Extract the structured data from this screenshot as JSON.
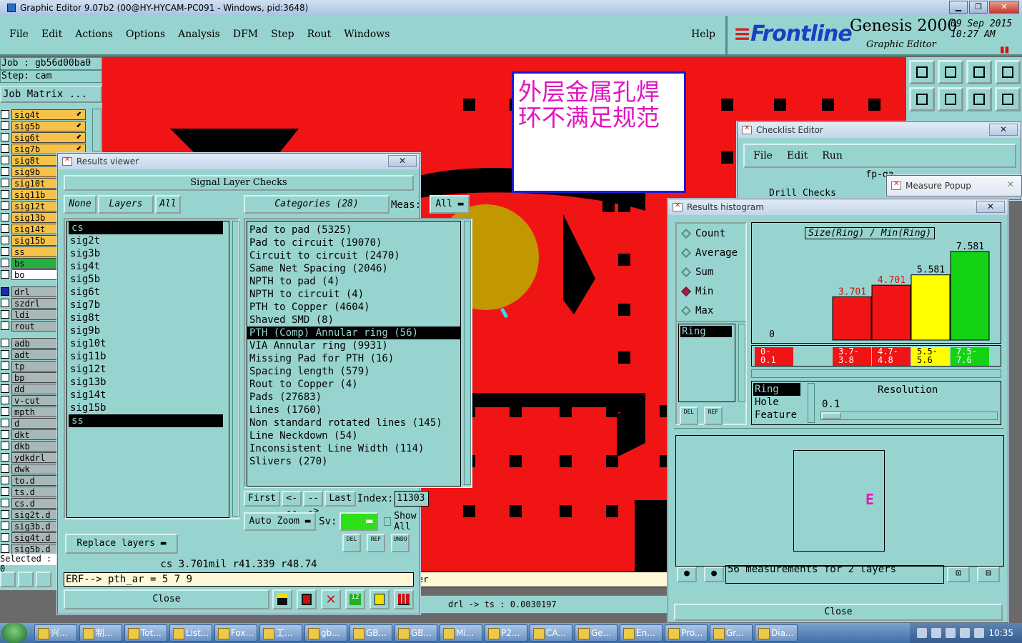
{
  "window": {
    "title": "Graphic Editor 9.07b2 (00@HY-HYCAM-PC091 - Windows, pid:3648)"
  },
  "menu": {
    "items": [
      "File",
      "Edit",
      "Actions",
      "Options",
      "Analysis",
      "DFM",
      "Step",
      "Rout",
      "Windows"
    ],
    "help": "Help"
  },
  "brand": {
    "logo": "Frontline",
    "product": "Genesis 2000",
    "subtitle": "Graphic Editor",
    "date": "09 Sep 2015",
    "time": "10:27 AM"
  },
  "left": {
    "job": "Job : gb56d00ba0",
    "step": "Step: cam",
    "job_matrix": "Job Matrix ...",
    "layers": [
      {
        "name": "sig4t",
        "color": "#f6c24a",
        "checked": false,
        "arrow": true
      },
      {
        "name": "sig5b",
        "color": "#f6c24a",
        "checked": false,
        "arrow": true
      },
      {
        "name": "sig6t",
        "color": "#f6c24a",
        "checked": false,
        "arrow": true
      },
      {
        "name": "sig7b",
        "color": "#f6c24a",
        "checked": false,
        "arrow": true
      },
      {
        "name": "sig8t",
        "color": "#f6c24a",
        "checked": false,
        "arrow": true
      },
      {
        "name": "sig9b",
        "color": "#f6c24a",
        "checked": false,
        "arrow": true
      },
      {
        "name": "sig10t",
        "color": "#f6c24a",
        "checked": false,
        "arrow": false
      },
      {
        "name": "sig11b",
        "color": "#f6c24a",
        "checked": false,
        "arrow": false
      },
      {
        "name": "sig12t",
        "color": "#f6c24a",
        "checked": false,
        "arrow": false
      },
      {
        "name": "sig13b",
        "color": "#f6c24a",
        "checked": false,
        "arrow": false
      },
      {
        "name": "sig14t",
        "color": "#f6c24a",
        "checked": false,
        "arrow": false
      },
      {
        "name": "sig15b",
        "color": "#f6c24a",
        "checked": false,
        "arrow": false
      },
      {
        "name": "ss",
        "color": "#f6c24a",
        "checked": false,
        "arrow": false
      },
      {
        "name": "bs",
        "color": "#25b040",
        "checked": false,
        "arrow": false
      },
      {
        "name": "bo",
        "color": "#ffffff",
        "checked": false,
        "arrow": false
      },
      {
        "name": "",
        "color": "#98d4cf",
        "checked": false,
        "arrow": false
      },
      {
        "name": "drl",
        "color": "#a8b8b8",
        "checked": true,
        "arrow": false
      },
      {
        "name": "szdrl",
        "color": "#a8b8b8",
        "checked": false,
        "arrow": false
      },
      {
        "name": "ldi",
        "color": "#a8b8b8",
        "checked": false,
        "arrow": false
      },
      {
        "name": "rout",
        "color": "#a8b8b8",
        "checked": false,
        "arrow": false
      },
      {
        "name": "",
        "color": "#98d4cf",
        "checked": false,
        "arrow": false
      },
      {
        "name": "adb",
        "color": "#a8b8b8",
        "checked": false,
        "arrow": false
      },
      {
        "name": "adt",
        "color": "#a8b8b8",
        "checked": false,
        "arrow": false
      },
      {
        "name": "tp",
        "color": "#a8b8b8",
        "checked": false,
        "arrow": false
      },
      {
        "name": "bp",
        "color": "#a8b8b8",
        "checked": false,
        "arrow": false
      },
      {
        "name": "dd",
        "color": "#a8b8b8",
        "checked": false,
        "arrow": false
      },
      {
        "name": "v-cut",
        "color": "#a8b8b8",
        "checked": false,
        "arrow": false
      },
      {
        "name": "mpth",
        "color": "#a8b8b8",
        "checked": false,
        "arrow": false
      },
      {
        "name": "d",
        "color": "#a8b8b8",
        "checked": false,
        "arrow": false
      },
      {
        "name": "dkt",
        "color": "#a8b8b8",
        "checked": false,
        "arrow": false
      },
      {
        "name": "dkb",
        "color": "#a8b8b8",
        "checked": false,
        "arrow": false
      },
      {
        "name": "ydkdrl",
        "color": "#a8b8b8",
        "checked": false,
        "arrow": false
      },
      {
        "name": "dwk",
        "color": "#a8b8b8",
        "checked": false,
        "arrow": false
      },
      {
        "name": "to.d",
        "color": "#a8b8b8",
        "checked": false,
        "arrow": false
      },
      {
        "name": "ts.d",
        "color": "#a8b8b8",
        "checked": false,
        "arrow": false
      },
      {
        "name": "cs.d",
        "color": "#a8b8b8",
        "checked": false,
        "arrow": false
      },
      {
        "name": "sig2t.d",
        "color": "#a8b8b8",
        "checked": false,
        "arrow": false
      },
      {
        "name": "sig3b.d",
        "color": "#a8b8b8",
        "checked": false,
        "arrow": false
      },
      {
        "name": "sig4t.d",
        "color": "#a8b8b8",
        "checked": false,
        "arrow": false
      },
      {
        "name": "sig5b.d",
        "color": "#a8b8b8",
        "checked": false,
        "arrow": false
      }
    ],
    "selected": "Selected : 0"
  },
  "canvas": {
    "annotation_line1": "外层金属孔焊",
    "annotation_line2": "环不满足规范"
  },
  "status": {
    "line1": "er",
    "line2": "drl -> ts : 0.0030197"
  },
  "results_viewer": {
    "title": "Results viewer",
    "header": "Signal Layer Checks",
    "none_label": "None",
    "layers_label": "Layers",
    "all_label": "All",
    "layers": [
      "cs",
      "sig2t",
      "sig3b",
      "sig4t",
      "sig5b",
      "sig6t",
      "sig7b",
      "sig8t",
      "sig9b",
      "sig10t",
      "sig11b",
      "sig12t",
      "sig13b",
      "sig14t",
      "sig15b",
      "ss"
    ],
    "categories_label": "Categories (28)",
    "meas_label": "Meas:",
    "meas_value": "All",
    "categories": [
      "Pad to pad (5325)",
      "Pad to circuit (19070)",
      "Circuit to circuit (2470)",
      "Same Net Spacing (2046)",
      "NPTH to pad (4)",
      "NPTH to circuit (4)",
      "PTH to Copper (4604)",
      "Shaved SMD (8)",
      "PTH (Comp) Annular ring (56)",
      "VIA Annular ring (9931)",
      "Missing Pad for PTH (16)",
      "Spacing length (579)",
      "Rout to Copper (4)",
      "Pads (27683)",
      "Lines (1760)",
      "Non standard rotated lines (145)",
      "Line Neckdown (54)",
      "Inconsistent Line Width (114)",
      "Slivers (270)"
    ],
    "selected_category": 8,
    "nav": {
      "first": "First",
      "prev": "<---",
      "next": "--->",
      "last": "Last",
      "index_label": "Index:",
      "index_value": "11303"
    },
    "auto_zoom": "Auto Zoom",
    "sv_label": "Sv:",
    "show_all": "Show All",
    "replace_layers": "Replace layers",
    "measurement": "cs 3.701mil   r41.339   r48.74",
    "erf": "ERF--> pth_ar = 5 7 9",
    "close": "Close",
    "small_buttons": [
      "DEL",
      "REF",
      "UNDO"
    ]
  },
  "checklist_editor": {
    "title": "Checklist Editor",
    "menu": [
      "File",
      "Edit",
      "Run"
    ],
    "name": "fp-qa",
    "row": "Drill Checks"
  },
  "measure_popup": {
    "title": "Measure Popup"
  },
  "histogram": {
    "title": "Results histogram",
    "options": [
      "Count",
      "Average",
      "Sum",
      "Min",
      "Max"
    ],
    "selected_option": "Min",
    "ring_item": "Ring",
    "left_buttons": [
      "DEL",
      "REF"
    ],
    "chart_title": "Size(Ring) / Min(Ring)",
    "bins": [
      "0-\n0.1",
      "3.7-\n3.8",
      "4.7-\n4.8",
      "5.5-\n5.6",
      "7.5-\n7.6"
    ],
    "breakdown": [
      "Ring",
      "Hole",
      "Feature"
    ],
    "resolution_label": "Resolution",
    "resolution_value": "0.1",
    "preview_glyph": "E",
    "message": "56 measurements for 2 layers",
    "close": "Close"
  },
  "chart_data": {
    "type": "bar",
    "title": "Size(Ring) / Min(Ring)",
    "categories": [
      "0-0.1",
      "3.7-3.8",
      "4.7-4.8",
      "5.5-5.6",
      "7.5-7.6"
    ],
    "values": [
      0,
      3.701,
      4.701,
      5.581,
      7.581
    ],
    "labels": [
      "0",
      "3.701",
      "4.701",
      "5.581",
      "7.581"
    ],
    "colors": [
      "#f01414",
      "#f01414",
      "#f01414",
      "#ffff00",
      "#14d214"
    ],
    "ylim": [
      0,
      7.581
    ]
  },
  "taskbar": {
    "items": [
      "兴...",
      "制...",
      "Tot...",
      "List...",
      "Fox...",
      "工...",
      "gb...",
      "GB...",
      "GB...",
      "Mi...",
      "P2...",
      "CA...",
      "Ge...",
      "En...",
      "Pro...",
      "Gr...",
      "Dia..."
    ],
    "clock": "10:35"
  }
}
